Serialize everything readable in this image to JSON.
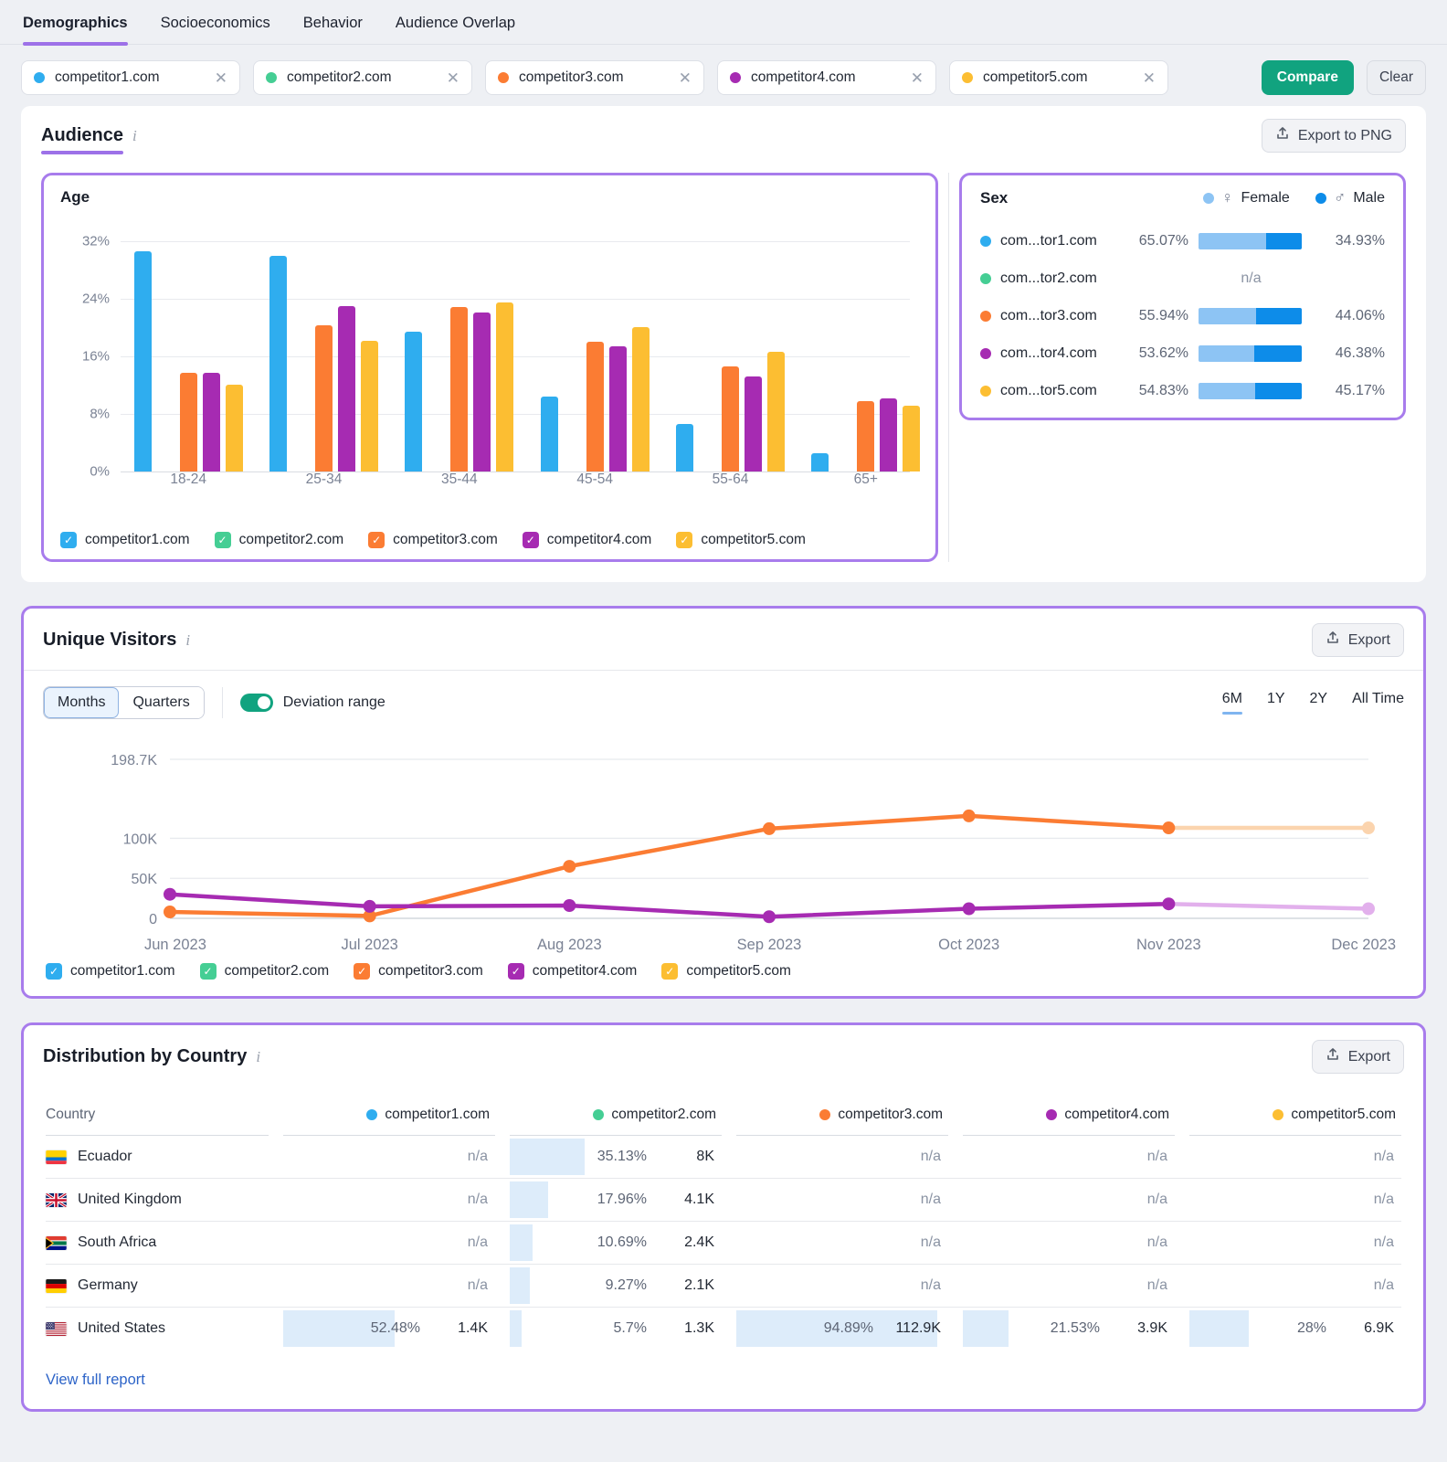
{
  "colors": {
    "accent_purple": "#9D71E8",
    "panel_border": "#A87CEC",
    "compare_green": "#11A37F",
    "link_blue": "#2D64C8",
    "female": "#8DC4F4",
    "male": "#0D8CE9",
    "grid": "#E8EAEE",
    "axis_text": "#7A8294",
    "table_fill": "#DDECFA",
    "faded_orange": "#FBD4AE",
    "faded_purple": "#E2B0EC"
  },
  "nav": {
    "tabs": [
      {
        "label": "Demographics",
        "active": true
      },
      {
        "label": "Socioeconomics",
        "active": false
      },
      {
        "label": "Behavior",
        "active": false
      },
      {
        "label": "Audience Overlap",
        "active": false
      }
    ]
  },
  "competitors": [
    {
      "label": "competitor1.com",
      "color": "#2FADEF"
    },
    {
      "label": "competitor2.com",
      "color": "#45CE94"
    },
    {
      "label": "competitor3.com",
      "color": "#FB7C33"
    },
    {
      "label": "competitor4.com",
      "color": "#A62BB2"
    },
    {
      "label": "competitor5.com",
      "color": "#FCBE32"
    }
  ],
  "chip_close_glyph": "✕",
  "compare_label": "Compare",
  "clear_label": "Clear",
  "audience": {
    "title": "Audience",
    "export_label": "Export to PNG",
    "age": {
      "title": "Age",
      "chart_data": {
        "type": "bar",
        "categories": [
          "18-24",
          "25-34",
          "35-44",
          "45-54",
          "55-64",
          "65+"
        ],
        "series": [
          {
            "name": "competitor1.com",
            "color": "#2FADEF",
            "values": [
              30.6,
              30.0,
              19.4,
              10.4,
              6.6,
              2.5
            ]
          },
          {
            "name": "competitor2.com",
            "color": "#45CE94",
            "values": [
              null,
              null,
              null,
              null,
              null,
              null
            ]
          },
          {
            "name": "competitor3.com",
            "color": "#FB7C33",
            "values": [
              13.7,
              20.3,
              22.8,
              18.0,
              14.6,
              9.8
            ]
          },
          {
            "name": "competitor4.com",
            "color": "#A62BB2",
            "values": [
              13.7,
              23.0,
              22.1,
              17.4,
              13.2,
              10.2
            ]
          },
          {
            "name": "competitor5.com",
            "color": "#FCBE32",
            "values": [
              12.1,
              18.2,
              23.5,
              20.1,
              16.6,
              9.1
            ]
          }
        ],
        "y_ticks": [
          {
            "label": "32%",
            "value": 32
          },
          {
            "label": "24%",
            "value": 24
          },
          {
            "label": "16%",
            "value": 16
          },
          {
            "label": "8%",
            "value": 8
          },
          {
            "label": "0%",
            "value": 0
          }
        ],
        "ylim": [
          0,
          34
        ],
        "grid": true,
        "legend_position": "bottom"
      }
    },
    "sex": {
      "title": "Sex",
      "female_label": "Female",
      "male_label": "Male",
      "female_symbol": "♀",
      "male_symbol": "♂",
      "na": "n/a",
      "rows": [
        {
          "site": "com...tor1.com",
          "female": "65.07%",
          "male": "34.93%",
          "female_pct": 65.07
        },
        {
          "site": "com...tor2.com",
          "female": null,
          "male": null,
          "female_pct": null
        },
        {
          "site": "com...tor3.com",
          "female": "55.94%",
          "male": "44.06%",
          "female_pct": 55.94
        },
        {
          "site": "com...tor4.com",
          "female": "53.62%",
          "male": "46.38%",
          "female_pct": 53.62
        },
        {
          "site": "com...tor5.com",
          "female": "54.83%",
          "male": "45.17%",
          "female_pct": 54.83
        }
      ]
    }
  },
  "unique_visitors": {
    "title": "Unique Visitors",
    "export_label": "Export",
    "granularity": [
      {
        "label": "Months",
        "active": true
      },
      {
        "label": "Quarters",
        "active": false
      }
    ],
    "deviation_label": "Deviation range",
    "deviation_on": true,
    "ranges": [
      {
        "label": "6M",
        "active": true
      },
      {
        "label": "1Y",
        "active": false
      },
      {
        "label": "2Y",
        "active": false
      },
      {
        "label": "All Time",
        "active": false
      }
    ],
    "chart_data": {
      "type": "line",
      "x": [
        "Jun 2023",
        "Jul 2023",
        "Aug 2023",
        "Sep 2023",
        "Oct 2023",
        "Nov 2023",
        "Dec 2023"
      ],
      "y_ticks": [
        {
          "label": "198.7K",
          "value": 198.7
        },
        {
          "label": "100K",
          "value": 100
        },
        {
          "label": "50K",
          "value": 50
        },
        {
          "label": "0",
          "value": 0
        }
      ],
      "ylim_k": [
        0,
        232
      ],
      "grid": true,
      "faded_last_segment": true,
      "series": [
        {
          "name": "competitor3.com",
          "color": "#FB7C33",
          "faded": "#FBD4AE",
          "values_k": [
            8,
            3,
            65,
            112,
            128,
            113,
            113
          ]
        },
        {
          "name": "competitor4.com",
          "color": "#A62BB2",
          "faded": "#E2B0EC",
          "values_k": [
            30,
            15,
            16,
            2,
            12,
            18,
            12
          ]
        }
      ]
    }
  },
  "country": {
    "title": "Distribution by Country",
    "export_label": "Export",
    "country_col": "Country",
    "na": "n/a",
    "link": "View full report",
    "rows": [
      {
        "country": "Ecuador",
        "flag": "ecuador",
        "cells": [
          null,
          {
            "pct": "35.13%",
            "value": "8K",
            "fill": 35.13
          },
          null,
          null,
          null
        ]
      },
      {
        "country": "United Kingdom",
        "flag": "uk",
        "cells": [
          null,
          {
            "pct": "17.96%",
            "value": "4.1K",
            "fill": 17.96
          },
          null,
          null,
          null
        ]
      },
      {
        "country": "South Africa",
        "flag": "south-africa",
        "cells": [
          null,
          {
            "pct": "10.69%",
            "value": "2.4K",
            "fill": 10.69
          },
          null,
          null,
          null
        ]
      },
      {
        "country": "Germany",
        "flag": "germany",
        "cells": [
          null,
          {
            "pct": "9.27%",
            "value": "2.1K",
            "fill": 9.27
          },
          null,
          null,
          null
        ]
      },
      {
        "country": "United States",
        "flag": "us",
        "cells": [
          {
            "pct": "52.48%",
            "value": "1.4K",
            "fill": 52.48
          },
          {
            "pct": "5.7%",
            "value": "1.3K",
            "fill": 5.7
          },
          {
            "pct": "94.89%",
            "value": "112.9K",
            "fill": 94.89
          },
          {
            "pct": "21.53%",
            "value": "3.9K",
            "fill": 21.53
          },
          {
            "pct": "28%",
            "value": "6.9K",
            "fill": 28
          }
        ]
      }
    ]
  }
}
